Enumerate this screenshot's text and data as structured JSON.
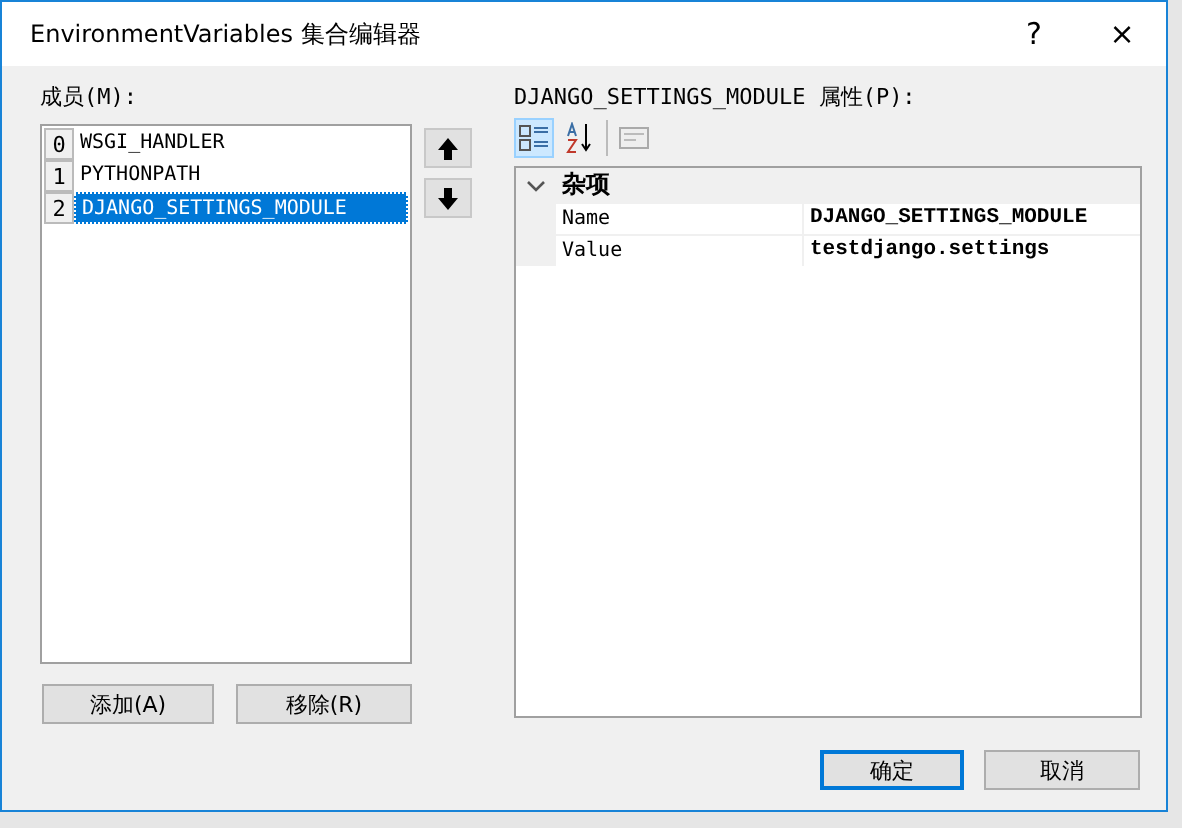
{
  "window": {
    "title": "EnvironmentVariables 集合编辑器",
    "help": "?",
    "close": "×"
  },
  "members": {
    "label": "成员(M):",
    "items": [
      {
        "index": "0",
        "name": "WSGI_HANDLER",
        "selected": false
      },
      {
        "index": "1",
        "name": "PYTHONPATH",
        "selected": false
      },
      {
        "index": "2",
        "name": "DJANGO_SETTINGS_MODULE",
        "selected": true
      }
    ],
    "add_button": "添加(A)",
    "remove_button": "移除(R)"
  },
  "properties": {
    "label": "DJANGO_SETTINGS_MODULE 属性(P):",
    "toolbar": [
      {
        "kind": "categorized",
        "selected": true
      },
      {
        "kind": "alphabetical",
        "selected": false
      },
      {
        "kind": "pages",
        "selected": false
      }
    ],
    "category": {
      "name": "杂项",
      "expanded": true
    },
    "rows": [
      {
        "name": "Name",
        "value": "DJANGO_SETTINGS_MODULE"
      },
      {
        "name": "Value",
        "value": "testdjango.settings"
      }
    ]
  },
  "footer_buttons": [
    {
      "label": "确定",
      "default": true
    },
    {
      "label": "取消",
      "default": false
    }
  ]
}
